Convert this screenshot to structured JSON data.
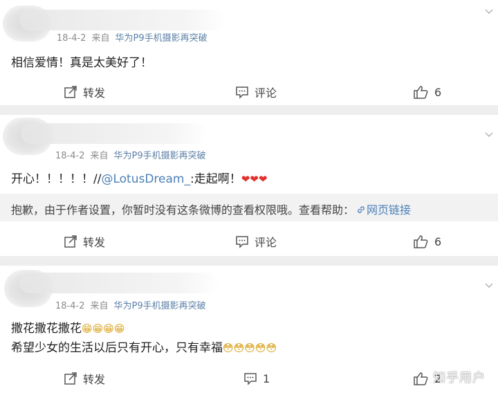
{
  "posts": [
    {
      "date": "18-4-2",
      "from_label": "来自",
      "source": "华为P9手机摄影再突破",
      "text": "相信爱情！真是太美好了！",
      "repost_label": "转发",
      "comment_label": "评论",
      "like_count": "6"
    },
    {
      "date": "18-4-2",
      "from_label": "来自",
      "source": "华为P9手机摄影再突破",
      "text_prefix": "开心！！！！！//",
      "mention": "@LotusDream_",
      "text_suffix": ":走起啊！",
      "hearts": "❤❤❤",
      "notice_text": "抱歉，由于作者设置，你暂时没有这条微博的查看权限哦。查看帮助：",
      "notice_link": "网页链接",
      "repost_label": "转发",
      "comment_label": "评论",
      "like_count": "6"
    },
    {
      "date": "18-4-2",
      "from_label": "来自",
      "source": "华为P9手机摄影再突破",
      "line1": "撒花撒花撒花",
      "line1_emoji": "😁😁😁😁",
      "line2": "希望少女的生活以后只有开心，只有幸福",
      "line2_emoji": "😳😳😳😳😳",
      "repost_label": "转发",
      "comment_count": "1",
      "like_count": "2"
    }
  ],
  "watermark": "知乎用户",
  "colors": {
    "link": "#4b7fb8",
    "source": "#5b7fa6",
    "divider": "#eeeeee",
    "notice_bg": "#f2f2f2"
  },
  "icons": {
    "repost": "repost-icon",
    "comment": "comment-icon",
    "like": "thumbs-up-icon",
    "more": "chevron-down-icon"
  }
}
